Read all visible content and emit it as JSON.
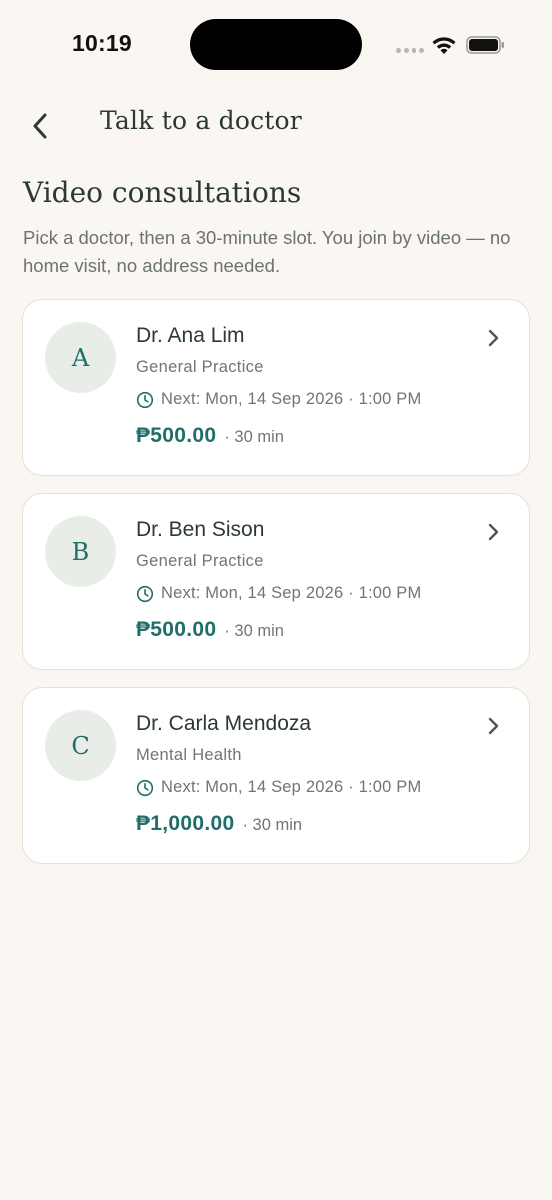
{
  "status_bar": {
    "time": "10:19"
  },
  "header": {
    "title": "Talk to a doctor",
    "back_icon": "chevron-left-icon"
  },
  "intro": {
    "title": "Video consultations",
    "description": "Pick a doctor, then a 30-minute slot. You join by video — no home visit, no address needed."
  },
  "doctors": [
    {
      "initial": "A",
      "name": "Dr. Ana Lim",
      "specialty": "General Practice",
      "next": "Next: Mon, 14 Sep 2026 · 1:00 PM",
      "price": "₱500.00",
      "duration": "· 30 min"
    },
    {
      "initial": "B",
      "name": "Dr. Ben Sison",
      "specialty": "General Practice",
      "next": "Next: Mon, 14 Sep 2026 · 1:00 PM",
      "price": "₱500.00",
      "duration": "· 30 min"
    },
    {
      "initial": "C",
      "name": "Dr. Carla Mendoza",
      "specialty": "Mental Health",
      "next": "Next: Mon, 14 Sep 2026 · 1:00 PM",
      "price": "₱1,000.00",
      "duration": "· 30 min"
    }
  ],
  "colors": {
    "background": "#faf6f1",
    "accent": "#1f6e6a",
    "card_border": "#e9e0d5",
    "avatar_bg": "#e9ede8"
  }
}
